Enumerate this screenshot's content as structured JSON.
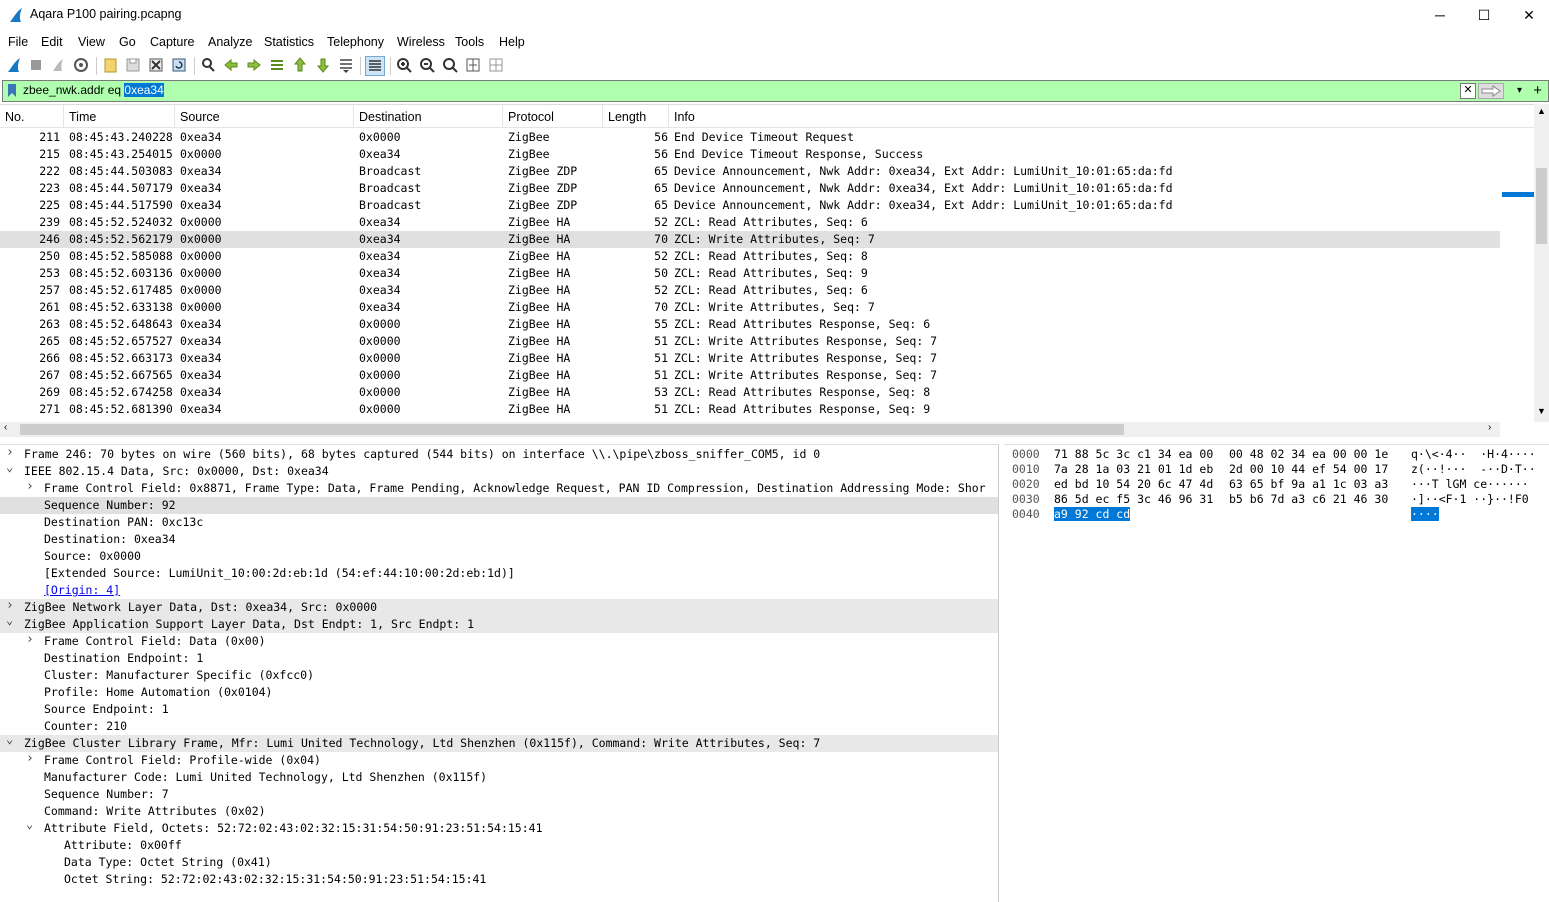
{
  "window": {
    "title": "Aqara P100 pairing.pcapng",
    "minimize": "─",
    "maximize": "☐",
    "close": "✕"
  },
  "menu": [
    "File",
    "Edit",
    "View",
    "Go",
    "Capture",
    "Analyze",
    "Statistics",
    "Telephony",
    "Wireless",
    "Tools",
    "Help"
  ],
  "filter": {
    "prefix": "zbee_nwk.addr eq ",
    "selected": "0xea34"
  },
  "columns": [
    "No.",
    "Time",
    "Source",
    "Destination",
    "Protocol",
    "Length",
    "Info"
  ],
  "packets": [
    {
      "no": "211",
      "time": "08:45:43.240228",
      "src": "0xea34",
      "dst": "0x0000",
      "proto": "ZigBee",
      "len": "56",
      "info": "End Device Timeout Request"
    },
    {
      "no": "215",
      "time": "08:45:43.254015",
      "src": "0x0000",
      "dst": "0xea34",
      "proto": "ZigBee",
      "len": "56",
      "info": "End Device Timeout Response, Success"
    },
    {
      "no": "222",
      "time": "08:45:44.503083",
      "src": "0xea34",
      "dst": "Broadcast",
      "proto": "ZigBee ZDP",
      "len": "65",
      "info": "Device Announcement, Nwk Addr: 0xea34, Ext Addr: LumiUnit_10:01:65:da:fd"
    },
    {
      "no": "223",
      "time": "08:45:44.507179",
      "src": "0xea34",
      "dst": "Broadcast",
      "proto": "ZigBee ZDP",
      "len": "65",
      "info": "Device Announcement, Nwk Addr: 0xea34, Ext Addr: LumiUnit_10:01:65:da:fd"
    },
    {
      "no": "225",
      "time": "08:45:44.517590",
      "src": "0xea34",
      "dst": "Broadcast",
      "proto": "ZigBee ZDP",
      "len": "65",
      "info": "Device Announcement, Nwk Addr: 0xea34, Ext Addr: LumiUnit_10:01:65:da:fd"
    },
    {
      "no": "239",
      "time": "08:45:52.524032",
      "src": "0x0000",
      "dst": "0xea34",
      "proto": "ZigBee HA",
      "len": "52",
      "info": "ZCL: Read Attributes, Seq: 6"
    },
    {
      "no": "246",
      "time": "08:45:52.562179",
      "src": "0x0000",
      "dst": "0xea34",
      "proto": "ZigBee HA",
      "len": "70",
      "info": "ZCL: Write Attributes, Seq: 7"
    },
    {
      "no": "250",
      "time": "08:45:52.585088",
      "src": "0x0000",
      "dst": "0xea34",
      "proto": "ZigBee HA",
      "len": "52",
      "info": "ZCL: Read Attributes, Seq: 8"
    },
    {
      "no": "253",
      "time": "08:45:52.603136",
      "src": "0x0000",
      "dst": "0xea34",
      "proto": "ZigBee HA",
      "len": "50",
      "info": "ZCL: Read Attributes, Seq: 9"
    },
    {
      "no": "257",
      "time": "08:45:52.617485",
      "src": "0x0000",
      "dst": "0xea34",
      "proto": "ZigBee HA",
      "len": "52",
      "info": "ZCL: Read Attributes, Seq: 6"
    },
    {
      "no": "261",
      "time": "08:45:52.633138",
      "src": "0x0000",
      "dst": "0xea34",
      "proto": "ZigBee HA",
      "len": "70",
      "info": "ZCL: Write Attributes, Seq: 7"
    },
    {
      "no": "263",
      "time": "08:45:52.648643",
      "src": "0xea34",
      "dst": "0x0000",
      "proto": "ZigBee HA",
      "len": "55",
      "info": "ZCL: Read Attributes Response, Seq: 6"
    },
    {
      "no": "265",
      "time": "08:45:52.657527",
      "src": "0xea34",
      "dst": "0x0000",
      "proto": "ZigBee HA",
      "len": "51",
      "info": "ZCL: Write Attributes Response, Seq: 7"
    },
    {
      "no": "266",
      "time": "08:45:52.663173",
      "src": "0xea34",
      "dst": "0x0000",
      "proto": "ZigBee HA",
      "len": "51",
      "info": "ZCL: Write Attributes Response, Seq: 7"
    },
    {
      "no": "267",
      "time": "08:45:52.667565",
      "src": "0xea34",
      "dst": "0x0000",
      "proto": "ZigBee HA",
      "len": "51",
      "info": "ZCL: Write Attributes Response, Seq: 7"
    },
    {
      "no": "269",
      "time": "08:45:52.674258",
      "src": "0xea34",
      "dst": "0x0000",
      "proto": "ZigBee HA",
      "len": "53",
      "info": "ZCL: Read Attributes Response, Seq: 8"
    },
    {
      "no": "271",
      "time": "08:45:52.681390",
      "src": "0xea34",
      "dst": "0x0000",
      "proto": "ZigBee HA",
      "len": "51",
      "info": "ZCL: Read Attributes Response, Seq: 9"
    }
  ],
  "selected_packet": "246",
  "details": [
    {
      "indent": 0,
      "arrow": "›",
      "text": "Frame 246: 70 bytes on wire (560 bits), 68 bytes captured (544 bits) on interface \\\\.\\pipe\\zboss_sniffer_COM5, id 0"
    },
    {
      "indent": 0,
      "arrow": "⌄",
      "text": "IEEE 802.15.4 Data, Src: 0x0000, Dst: 0xea34"
    },
    {
      "indent": 1,
      "arrow": "›",
      "text": "Frame Control Field: 0x8871, Frame Type: Data, Frame Pending, Acknowledge Request, PAN ID Compression, Destination Addressing Mode: Shor"
    },
    {
      "indent": 1,
      "arrow": "",
      "text": "Sequence Number: 92",
      "sel": true
    },
    {
      "indent": 1,
      "arrow": "",
      "text": "Destination PAN: 0xc13c"
    },
    {
      "indent": 1,
      "arrow": "",
      "text": "Destination: 0xea34"
    },
    {
      "indent": 1,
      "arrow": "",
      "text": "Source: 0x0000"
    },
    {
      "indent": 1,
      "arrow": "",
      "text": "[Extended Source: LumiUnit_10:00:2d:eb:1d (54:ef:44:10:00:2d:eb:1d)]"
    },
    {
      "indent": 1,
      "arrow": "",
      "text": "[Origin: 4]",
      "link": true
    },
    {
      "indent": 0,
      "arrow": "›",
      "text": "ZigBee Network Layer Data, Dst: 0xea34, Src: 0x0000",
      "hl": true
    },
    {
      "indent": 0,
      "arrow": "⌄",
      "text": "ZigBee Application Support Layer Data, Dst Endpt: 1, Src Endpt: 1",
      "hl": true
    },
    {
      "indent": 1,
      "arrow": "›",
      "text": "Frame Control Field: Data (0x00)"
    },
    {
      "indent": 1,
      "arrow": "",
      "text": "Destination Endpoint: 1"
    },
    {
      "indent": 1,
      "arrow": "",
      "text": "Cluster: Manufacturer Specific (0xfcc0)"
    },
    {
      "indent": 1,
      "arrow": "",
      "text": "Profile: Home Automation (0x0104)"
    },
    {
      "indent": 1,
      "arrow": "",
      "text": "Source Endpoint: 1"
    },
    {
      "indent": 1,
      "arrow": "",
      "text": "Counter: 210"
    },
    {
      "indent": 0,
      "arrow": "⌄",
      "text": "ZigBee Cluster Library Frame, Mfr: Lumi United Technology, Ltd Shenzhen (0x115f), Command: Write Attributes, Seq: 7",
      "hl": true
    },
    {
      "indent": 1,
      "arrow": "›",
      "text": "Frame Control Field: Profile-wide (0x04)"
    },
    {
      "indent": 1,
      "arrow": "",
      "text": "Manufacturer Code: Lumi United Technology, Ltd Shenzhen (0x115f)"
    },
    {
      "indent": 1,
      "arrow": "",
      "text": "Sequence Number: 7"
    },
    {
      "indent": 1,
      "arrow": "",
      "text": "Command: Write Attributes (0x02)"
    },
    {
      "indent": 1,
      "arrow": "⌄",
      "text": "Attribute Field, Octets: 52:72:02:43:02:32:15:31:54:50:91:23:51:54:15:41"
    },
    {
      "indent": 2,
      "arrow": "",
      "text": "Attribute: 0x00ff"
    },
    {
      "indent": 2,
      "arrow": "",
      "text": "Data Type: Octet String (0x41)"
    },
    {
      "indent": 2,
      "arrow": "",
      "text": "Octet String: 52:72:02:43:02:32:15:31:54:50:91:23:51:54:15:41"
    }
  ],
  "bytes": [
    {
      "off": "0000",
      "h1": "71 88 5c 3c c1 34 ea 00",
      "h2": "00 48 02 34 ea 00 00 1e",
      "ascii": "q·\\<·4··  ·H·4····"
    },
    {
      "off": "0010",
      "h1": "7a 28 1a 03 21 01 1d eb",
      "h2": "2d 00 10 44 ef 54 00 17",
      "ascii": "z(··!···  -··D·T··"
    },
    {
      "off": "0020",
      "h1": "ed bd 10 54 20 6c 47 4d",
      "h2": "63 65 bf 9a a1 1c 03 a3",
      "ascii": "···T lGM ce······"
    },
    {
      "off": "0030",
      "h1": "86 5d ec f5 3c 46 96 31",
      "h2": "b5 b6 7d a3 c6 21 46 30",
      "ascii": "·]··<F·1 ··}··!F0"
    },
    {
      "off": "0040",
      "h1": "a9 92 cd cd",
      "h2": "",
      "ascii": "····",
      "sel": true
    }
  ],
  "colors": {
    "filter_bg": "#afffaf",
    "selection": "#0078d7",
    "row_selected": "#e0e0e0"
  }
}
